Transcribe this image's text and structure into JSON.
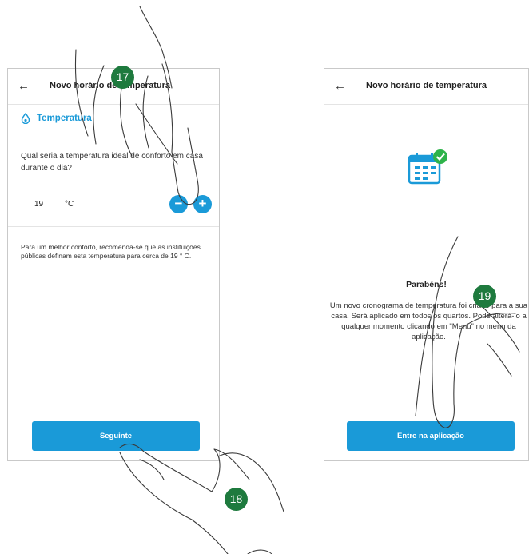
{
  "left_screen": {
    "header": {
      "back_icon": "←",
      "title": "Novo horário de temperatura"
    },
    "section": {
      "icon": "drop-icon",
      "label": "Temperatura"
    },
    "question": "Qual seria a temperatura ideal de conforto em casa durante o dia?",
    "temperature": {
      "value": "19",
      "unit": "°C",
      "minus": "−",
      "plus": "+"
    },
    "tip": "Para um melhor conforto, recomenda-se que as instituições públicas definam esta temperatura para cerca de 19 ° C.",
    "next_button": "Seguinte"
  },
  "right_screen": {
    "header": {
      "back_icon": "←",
      "title": "Novo horário de temperatura"
    },
    "illustration": "calendar-check-icon",
    "congrats_title": "Parabéns!",
    "congrats_body": "Um novo cronograma de temperatura foi criado para a sua casa. Será aplicado em todos os quartos. Pode alterá-lo a qualquer momento clicando em \"Menu\" no menu da aplicação.",
    "enter_button": "Entre na aplicação"
  },
  "steps": {
    "a": "17",
    "b": "18",
    "c": "19"
  },
  "colors": {
    "accent": "#1a9ad8",
    "badge": "#1e7a3e",
    "check": "#2db34a"
  }
}
